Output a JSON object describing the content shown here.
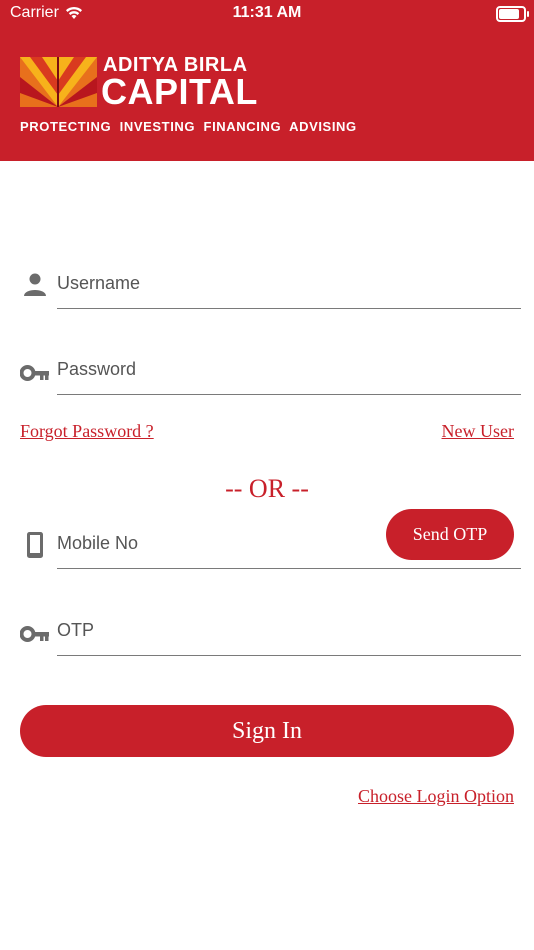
{
  "status_bar": {
    "carrier": "Carrier",
    "time": "11:31 AM",
    "battery_level": 0.92
  },
  "header": {
    "brand_line1": "ADITYA BIRLA",
    "brand_line2": "CAPITAL",
    "tagline": "PROTECTING  INVESTING  FINANCING  ADVISING",
    "background_color": "#c8202a"
  },
  "form": {
    "username_placeholder": "Username",
    "password_placeholder": "Password",
    "forgot_password": "Forgot Password ?",
    "new_user": "New User",
    "or_divider": "-- OR --",
    "mobile_placeholder": "Mobile No",
    "send_otp": "Send OTP",
    "otp_placeholder": "OTP",
    "sign_in": "Sign In",
    "choose_login_option": "Choose Login Option"
  },
  "colors": {
    "accent": "#c8202a",
    "icon_gray": "#6b6b6b"
  },
  "icons": [
    "person-icon",
    "key-icon",
    "mobile-phone-icon",
    "wifi-icon",
    "battery-icon"
  ]
}
